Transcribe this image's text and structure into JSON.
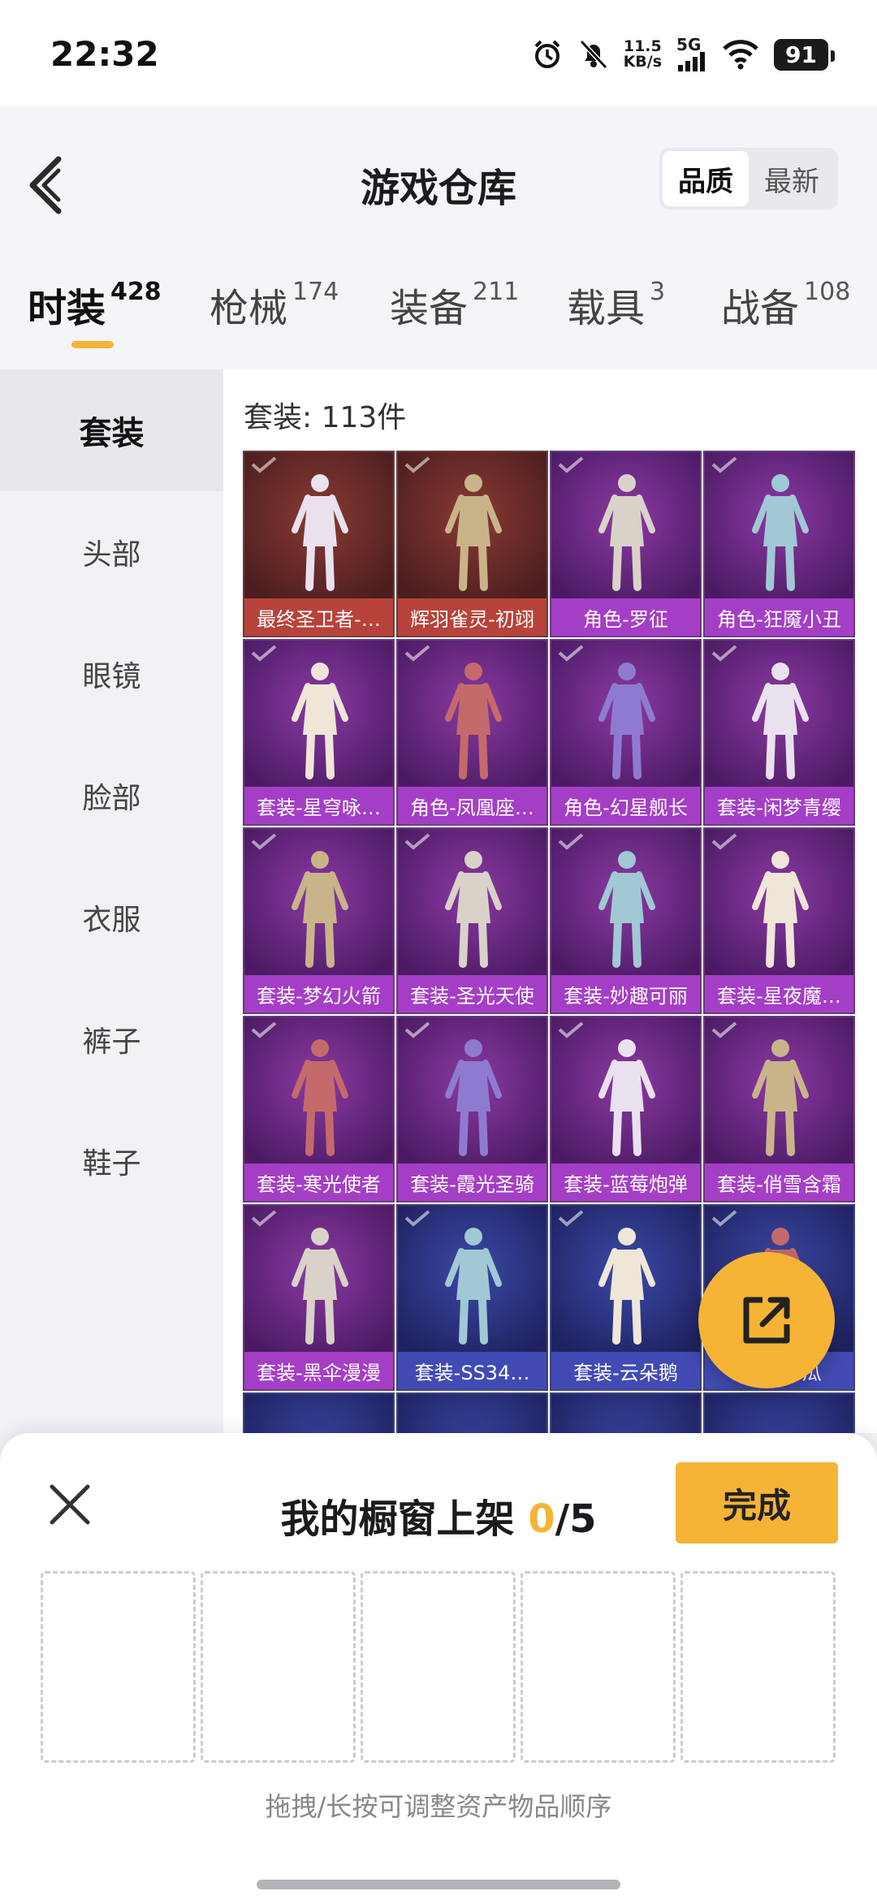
{
  "status_bar": {
    "time": "22:32",
    "speed_value": "11.5",
    "speed_unit": "KB/s",
    "network": "5G",
    "battery": "91",
    "icons": [
      "alarm-icon",
      "mute-icon",
      "signal-icon",
      "wifi-icon",
      "battery-icon"
    ]
  },
  "header": {
    "title": "游戏仓库",
    "sort_options": [
      "品质",
      "最新"
    ],
    "sort_selected": "品质"
  },
  "tabs": [
    {
      "label": "时装",
      "count": "428"
    },
    {
      "label": "枪械",
      "count": "174"
    },
    {
      "label": "装备",
      "count": "211"
    },
    {
      "label": "载具",
      "count": "3"
    },
    {
      "label": "战备",
      "count": "108"
    }
  ],
  "sidebar": {
    "items": [
      "套装",
      "头部",
      "眼镜",
      "脸部",
      "衣服",
      "裤子",
      "鞋子"
    ]
  },
  "content": {
    "count_label": "套装: 113件",
    "items": [
      {
        "name": "最终圣卫者-…",
        "rarity": "red"
      },
      {
        "name": "辉羽雀灵-初翊",
        "rarity": "red"
      },
      {
        "name": "角色-罗征",
        "rarity": "purple"
      },
      {
        "name": "角色-狂魇小丑",
        "rarity": "purple"
      },
      {
        "name": "套装-星穹咏…",
        "rarity": "purple"
      },
      {
        "name": "角色-凤凰座…",
        "rarity": "purple"
      },
      {
        "name": "角色-幻星舰长",
        "rarity": "purple"
      },
      {
        "name": "套装-闲梦青缨",
        "rarity": "purple"
      },
      {
        "name": "套装-梦幻火箭",
        "rarity": "purple"
      },
      {
        "name": "套装-圣光天使",
        "rarity": "purple"
      },
      {
        "name": "套装-妙趣可丽",
        "rarity": "purple"
      },
      {
        "name": "套装-星夜魔…",
        "rarity": "purple"
      },
      {
        "name": "套装-寒光使者",
        "rarity": "purple"
      },
      {
        "name": "套装-霞光圣骑",
        "rarity": "purple"
      },
      {
        "name": "套装-蓝莓炮弹",
        "rarity": "purple"
      },
      {
        "name": "套装-俏雪含霜",
        "rarity": "purple"
      },
      {
        "name": "套装-黑伞漫漫",
        "rarity": "purple"
      },
      {
        "name": "套装-SS34…",
        "rarity": "blue"
      },
      {
        "name": "套装-云朵鹅",
        "rarity": "blue"
      },
      {
        "name": "套装-…瓜",
        "rarity": "blue"
      }
    ]
  },
  "sheet": {
    "title_prefix": "我的橱窗上架 ",
    "current": "0",
    "total": "/5",
    "done_label": "完成",
    "hint": "拖拽/长按可调整资产物品顺序"
  },
  "colors": {
    "accent": "#f5b436",
    "rarity_red": "#b7433a",
    "rarity_purple": "#a53ec6",
    "rarity_blue": "#414bb3"
  }
}
